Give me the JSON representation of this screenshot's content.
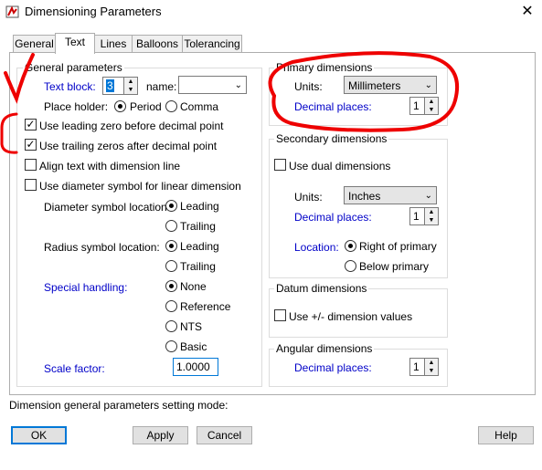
{
  "window": {
    "title": "Dimensioning Parameters"
  },
  "tabs": [
    "General",
    "Text",
    "Lines",
    "Balloons",
    "Tolerancing"
  ],
  "general": {
    "legend": "General parameters",
    "text_block_label": "Text block:",
    "text_block_value": "3",
    "name_label": "name:",
    "name_value": "",
    "place_holder_label": "Place holder:",
    "place_holder_options": [
      "Period",
      "Comma"
    ],
    "place_holder_selected": "Period",
    "checkboxes": [
      {
        "label": "Use leading zero before decimal point",
        "checked": true
      },
      {
        "label": "Use trailing zeros after decimal point",
        "checked": true
      },
      {
        "label": "Align text with dimension line",
        "checked": false
      },
      {
        "label": "Use diameter symbol for linear dimension",
        "checked": false
      }
    ],
    "diameter_label": "Diameter symbol location:",
    "diameter_options": [
      "Leading",
      "Trailing"
    ],
    "diameter_selected": "Leading",
    "radius_label": "Radius symbol location:",
    "radius_options": [
      "Leading",
      "Trailing"
    ],
    "radius_selected": "Leading",
    "special_label": "Special handling:",
    "special_options": [
      "None",
      "Reference",
      "NTS",
      "Basic"
    ],
    "special_selected": "None",
    "scale_label": "Scale factor:",
    "scale_value": "1.0000"
  },
  "primary": {
    "legend": "Primary dimensions",
    "units_label": "Units:",
    "units_value": "Millimeters",
    "decimal_label": "Decimal places:",
    "decimal_value": "1"
  },
  "secondary": {
    "legend": "Secondary dimensions",
    "dual_label": "Use dual dimensions",
    "dual_checked": false,
    "units_label": "Units:",
    "units_value": "Inches",
    "decimal_label": "Decimal places:",
    "decimal_value": "1",
    "location_label": "Location:",
    "location_options": [
      "Right of primary",
      "Below primary"
    ],
    "location_selected": "Right of primary"
  },
  "datum": {
    "legend": "Datum dimensions",
    "checkbox_label": "Use +/- dimension values",
    "checked": false
  },
  "angular": {
    "legend": "Angular dimensions",
    "decimal_label": "Decimal places:",
    "decimal_value": "1"
  },
  "status_text": "Dimension general parameters setting mode:",
  "buttons": {
    "ok": "OK",
    "apply": "Apply",
    "cancel": "Cancel",
    "help": "Help"
  },
  "colors": {
    "annotation": "#ee0000",
    "link_blue": "#0000c8",
    "focus_blue": "#0078d7"
  }
}
